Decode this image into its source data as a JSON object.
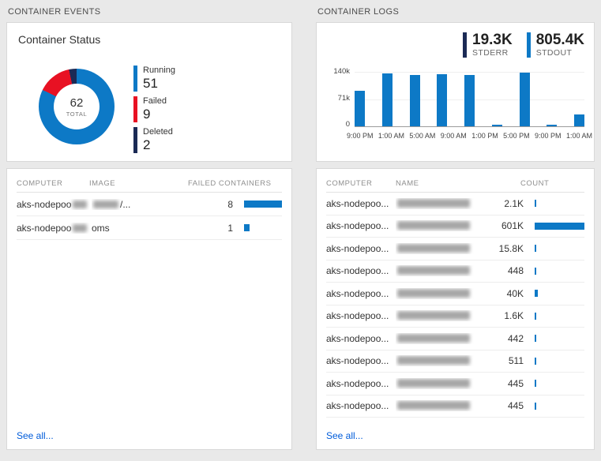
{
  "colors": {
    "blue": "#0d79c6",
    "red": "#e81123",
    "navy": "#1b2a55",
    "link": "#015cda"
  },
  "panels": {
    "events": {
      "header": "CONTAINER EVENTS",
      "status": {
        "title": "Container Status",
        "total_value": "62",
        "total_label": "TOTAL",
        "legend": [
          {
            "label": "Running",
            "value": "51",
            "color": "#0d79c6"
          },
          {
            "label": "Failed",
            "value": "9",
            "color": "#e81123"
          },
          {
            "label": "Deleted",
            "value": "2",
            "color": "#1b2a55"
          }
        ]
      },
      "table": {
        "columns": [
          "COMPUTER",
          "IMAGE",
          "FAILED CONTAINERS"
        ],
        "rows": [
          {
            "computer": "aks-nodepoo",
            "computer_redacted": true,
            "image": "/...",
            "image_redacted": true,
            "count": "8",
            "count_num": 8
          },
          {
            "computer": "aks-nodepoo",
            "computer_redacted": true,
            "image": "oms",
            "image_redacted": false,
            "count": "1",
            "count_num": 1
          }
        ],
        "see_all": "See all..."
      }
    },
    "logs": {
      "header": "CONTAINER LOGS",
      "stats": [
        {
          "value": "19.3K",
          "label": "STDERR",
          "color": "#1b2a55"
        },
        {
          "value": "805.4K",
          "label": "STDOUT",
          "color": "#0d79c6"
        }
      ],
      "table": {
        "columns": [
          "COMPUTER",
          "NAME",
          "COUNT"
        ],
        "rows": [
          {
            "computer": "aks-nodepoo...",
            "name_redacted": true,
            "count": "2.1K",
            "count_num": 2100
          },
          {
            "computer": "aks-nodepoo...",
            "name_redacted": true,
            "count": "601K",
            "count_num": 601000
          },
          {
            "computer": "aks-nodepoo...",
            "name_redacted": true,
            "count": "15.8K",
            "count_num": 15800
          },
          {
            "computer": "aks-nodepoo...",
            "name_redacted": true,
            "count": "448",
            "count_num": 448
          },
          {
            "computer": "aks-nodepoo...",
            "name_redacted": true,
            "count": "40K",
            "count_num": 40000
          },
          {
            "computer": "aks-nodepoo...",
            "name_redacted": true,
            "count": "1.6K",
            "count_num": 1600
          },
          {
            "computer": "aks-nodepoo...",
            "name_redacted": true,
            "count": "442",
            "count_num": 442
          },
          {
            "computer": "aks-nodepoo...",
            "name_redacted": true,
            "count": "511",
            "count_num": 511
          },
          {
            "computer": "aks-nodepoo...",
            "name_redacted": true,
            "count": "445",
            "count_num": 445
          },
          {
            "computer": "aks-nodepoo...",
            "name_redacted": true,
            "count": "445",
            "count_num": 445
          }
        ],
        "see_all": "See all..."
      }
    }
  },
  "chart_data": [
    {
      "type": "pie",
      "title": "Container Status",
      "labels": [
        "Running",
        "Failed",
        "Deleted"
      ],
      "values": [
        51,
        9,
        2
      ],
      "center_total": 62,
      "colors": [
        "#0d79c6",
        "#e81123",
        "#1b2a55"
      ]
    },
    {
      "type": "bar",
      "title": "",
      "x_ticks": [
        "9:00 PM",
        "1:00 AM",
        "5:00 AM",
        "9:00 AM",
        "1:00 PM",
        "5:00 PM",
        "9:00 PM",
        "1:00 AM"
      ],
      "y_ticks": [
        "140k",
        "71k",
        "0"
      ],
      "ylim": [
        0,
        140000
      ],
      "values": [
        90000,
        134000,
        130000,
        132000,
        130000,
        2000,
        136000,
        2000,
        31000
      ],
      "color": "#0d79c6",
      "legend_position": "top-right",
      "grid": true
    }
  ]
}
